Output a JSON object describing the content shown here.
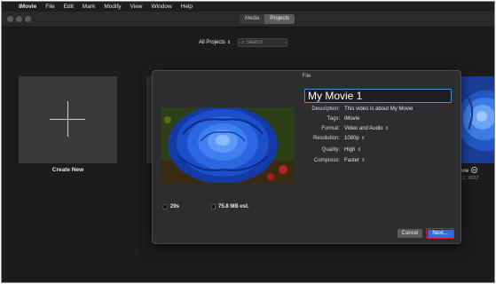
{
  "menubar": {
    "apple_icon": "apple-icon",
    "app_name": "iMovie",
    "items": [
      "File",
      "Edit",
      "Mark",
      "Modify",
      "View",
      "Window",
      "Help"
    ]
  },
  "toolbar": {
    "tabs": [
      {
        "label": "Media",
        "active": false
      },
      {
        "label": "Projects",
        "active": true
      }
    ]
  },
  "filter": {
    "label": "All Projects",
    "search_placeholder": "Search"
  },
  "create_new": {
    "label": "Create New"
  },
  "right_project": {
    "name_fragment": "vie",
    "date_fragment": "2, 2022"
  },
  "dialog": {
    "title": "File",
    "project_title": "My Movie 1",
    "fields": {
      "description": {
        "label": "Description:",
        "value": "This video is about My Movie"
      },
      "tags": {
        "label": "Tags:",
        "value": "iMovie"
      },
      "format": {
        "label": "Format:",
        "value": "Video and Audio"
      },
      "resolution": {
        "label": "Resolution:",
        "value": "1080p"
      },
      "quality": {
        "label": "Quality:",
        "value": "High"
      },
      "compress": {
        "label": "Compress:",
        "value": "Faster"
      }
    },
    "duration": "29s",
    "file_size": "75.8 MB est.",
    "cancel_label": "Cancel",
    "next_label": "Next..."
  },
  "colors": {
    "accent": "#2f6ee0",
    "highlight_border": "#d0212b",
    "focus_ring": "#4a8fd9"
  }
}
